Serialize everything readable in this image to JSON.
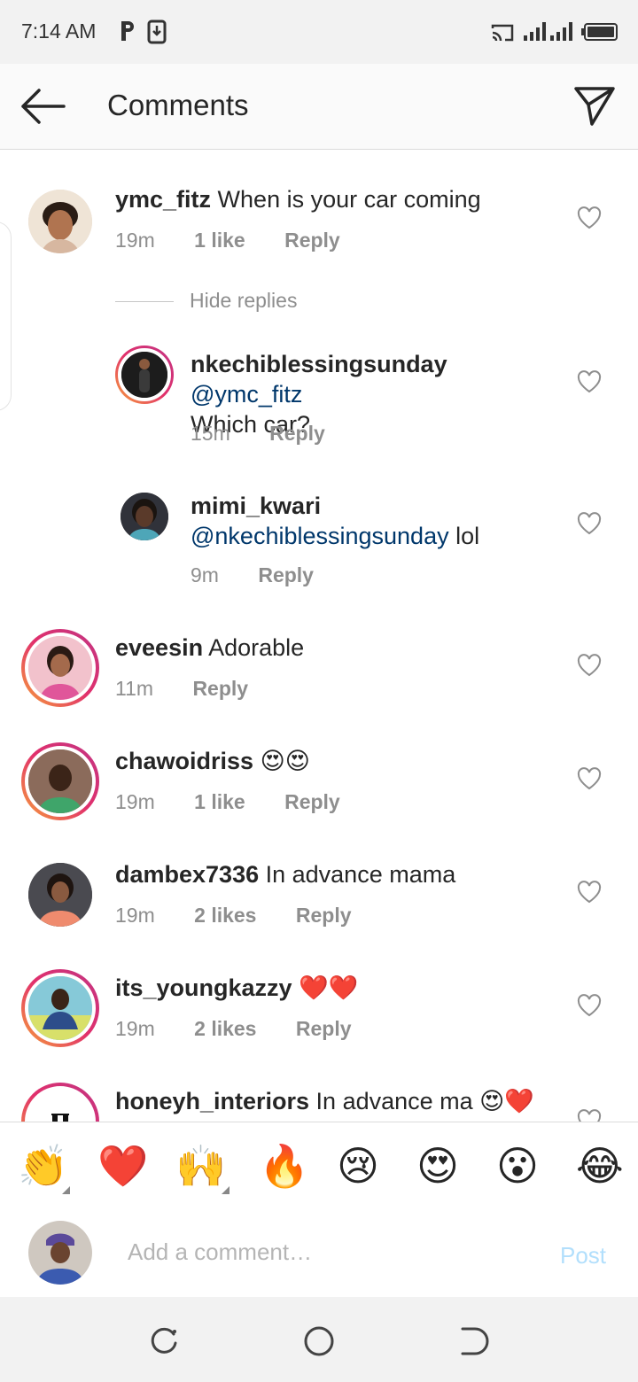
{
  "status_bar": {
    "time": "7:14 AM",
    "icons": [
      "parking-icon",
      "download-icon",
      "cast-icon",
      "signal-icon",
      "signal-icon",
      "battery-icon"
    ]
  },
  "header": {
    "title": "Comments",
    "back_icon": "arrow-left-icon",
    "share_icon": "paper-plane-icon"
  },
  "comments": [
    {
      "username": "ymc_fitz",
      "text": " When is your car coming",
      "time": "19m",
      "likes": "1 like",
      "reply": "Reply"
    },
    {
      "hide_replies": "Hide replies"
    },
    {
      "username": "nkechiblessingsunday",
      "mention": "@ymc_fitz",
      "text": "Which car?",
      "time": "15m",
      "reply": "Reply"
    },
    {
      "username": "mimi_kwari",
      "mention": "@nkechiblessingsunday",
      "text": " lol",
      "time": "9m",
      "reply": "Reply"
    },
    {
      "username": "eveesin",
      "text": " Adorable",
      "time": "11m",
      "reply": "Reply"
    },
    {
      "username": "chawoidriss",
      "text": " 😍😍",
      "time": "19m",
      "likes": "1 like",
      "reply": "Reply"
    },
    {
      "username": "dambex7336",
      "text": " In advance mama",
      "time": "19m",
      "likes": "2 likes",
      "reply": "Reply"
    },
    {
      "username": "its_youngkazzy",
      "text": " ❤️❤️",
      "time": "19m",
      "likes": "2 likes",
      "reply": "Reply"
    },
    {
      "username": "honeyh_interiors",
      "text": " In advance ma 😍❤️"
    }
  ],
  "emoji_bar": [
    "👏",
    "❤️",
    "🙌",
    "🔥",
    "😢",
    "😍",
    "😮",
    "😂"
  ],
  "composer": {
    "placeholder": "Add a comment…",
    "post_label": "Post"
  },
  "colors": {
    "mention": "#00376b",
    "post_disabled": "#b2dffc",
    "meta": "#8e8e8e"
  }
}
